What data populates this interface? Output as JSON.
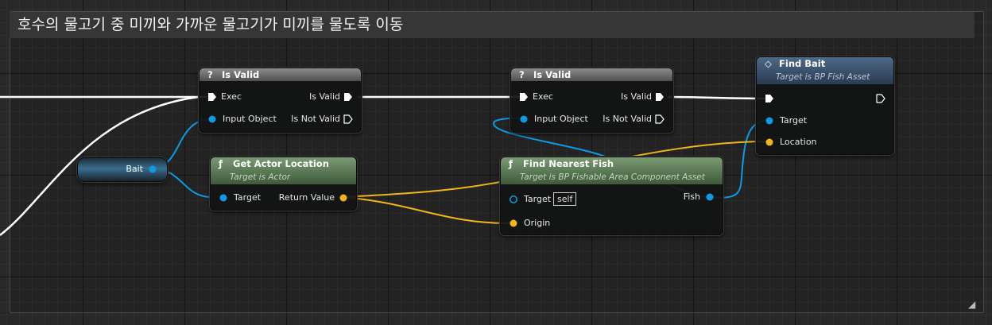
{
  "comment": {
    "title": "호수의 물고기 중 미끼와 가까운 물고기가 미끼를 물도록 이동"
  },
  "colors": {
    "exec": "#ffffff",
    "object": "#0e9be6",
    "vector": "#f2b41b"
  },
  "icons": {
    "resize": "resize-grip-icon"
  },
  "nodes": {
    "is_valid_1": {
      "title": "Is Valid",
      "icon": "?",
      "exec": "Exec",
      "input_object": "Input Object",
      "is_valid": "Is Valid",
      "is_not_valid": "Is Not Valid"
    },
    "is_valid_2": {
      "title": "Is Valid",
      "icon": "?",
      "exec": "Exec",
      "input_object": "Input Object",
      "is_valid": "Is Valid",
      "is_not_valid": "Is Not Valid"
    },
    "bait_var": {
      "label": "Bait"
    },
    "get_actor_location": {
      "title": "Get Actor Location",
      "icon": "ƒ",
      "subtitle": "Target is Actor",
      "target": "Target",
      "return_value": "Return Value"
    },
    "find_nearest_fish": {
      "title": "Find Nearest Fish",
      "icon": "ƒ",
      "subtitle": "Target is BP Fishable Area Component Asset",
      "target": "Target",
      "self": "self",
      "origin": "Origin",
      "fish": "Fish"
    },
    "find_bait": {
      "title": "Find Bait",
      "icon": "◇",
      "subtitle": "Target is BP Fish Asset",
      "target": "Target",
      "location": "Location"
    }
  }
}
